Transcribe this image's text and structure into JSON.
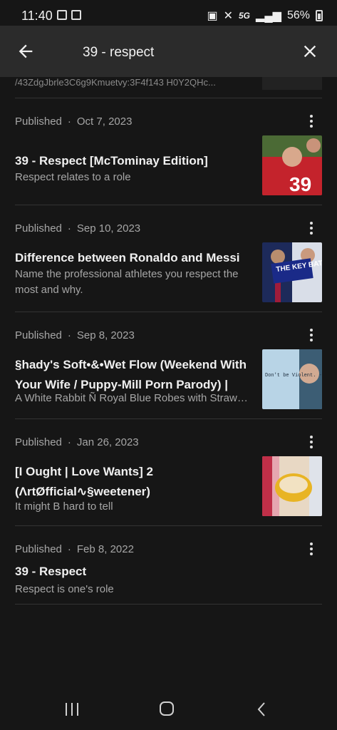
{
  "status": {
    "time": "11:40",
    "network": "5G",
    "battery": "56%"
  },
  "search": {
    "query": "39 - respect"
  },
  "partial": {
    "text": "/43ZdgJbrle3C6g9Kmuetvy:3F4f143 H0Y2QHc..."
  },
  "results": [
    {
      "status": "Published",
      "date": "Oct 7, 2023",
      "title": "39 - Respect [McTominay Edition]",
      "desc": "Respect relates to a role",
      "thumb_overlay": "39"
    },
    {
      "status": "Published",
      "date": "Sep 10, 2023",
      "title": "Difference between Ronaldo and Messi",
      "desc": "Name the professional athletes you respect the most and why.",
      "thumb_overlay": "THE KEY BATTLE"
    },
    {
      "status": "Published",
      "date": "Sep 8, 2023",
      "title": "§hady's Soft•&•Wet Flow (Weekend With Your Wife / Puppy-Mill Porn Parody) | [Flow...",
      "desc": "A White Rabbit Ñ Royal Blue Robes with Strawb...",
      "thumb_overlay": "Don't be Violent. -Eminem"
    },
    {
      "status": "Published",
      "date": "Jan 26, 2023",
      "title": "[I Ought | Love Wants] 2 (ΛrtØfficial∿§weetener)",
      "desc": "It might B hard to tell",
      "thumb_overlay": ""
    },
    {
      "status": "Published",
      "date": "Feb 8, 2022",
      "title": "39 - Respect",
      "desc": "Respect is one's role",
      "thumb_overlay": ""
    }
  ],
  "icons": {
    "back": "arrow-left-icon",
    "close": "close-icon",
    "more": "more-vert-icon"
  },
  "colors": {
    "background": "#161616",
    "header": "#2b2b2b",
    "text": "#f0f0f0",
    "muted": "#a6a6a6"
  }
}
